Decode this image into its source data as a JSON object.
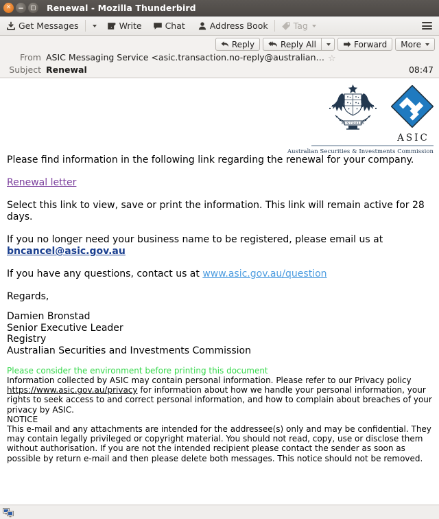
{
  "window": {
    "title": "Renewal - Mozilla Thunderbird",
    "controls": {
      "close": "close-button",
      "minimize": "minimize-button",
      "maximize": "maximize-button"
    }
  },
  "toolbar": {
    "get_messages": "Get Messages",
    "get_messages_icon": "download-inbox-icon",
    "get_messages_dropdown": "chevron-down-icon",
    "write": "Write",
    "write_icon": "compose-pencil-icon",
    "chat": "Chat",
    "chat_icon": "speech-bubble-icon",
    "address_book": "Address Book",
    "address_book_icon": "person-icon",
    "tag": "Tag",
    "tag_icon": "tag-icon",
    "app_menu_icon": "hamburger-menu-icon"
  },
  "message_actions": {
    "reply": "Reply",
    "reply_icon": "reply-arrow-icon",
    "reply_all": "Reply All",
    "reply_all_icon": "reply-all-arrow-icon",
    "reply_all_dropdown": "chevron-down-icon",
    "forward": "Forward",
    "forward_icon": "forward-arrow-icon",
    "more": "More",
    "more_dropdown": "chevron-down-icon"
  },
  "message_header": {
    "from_label": "From",
    "from_value": "ASIC Messaging Service <asic.transaction.no-reply@australian…",
    "star_icon": "star-outline-icon",
    "subject_label": "Subject",
    "subject_value": "Renewal",
    "time": "08:47"
  },
  "email": {
    "logo": {
      "coat_of_arms_icon": "australian-coat-of-arms-icon",
      "asic_diamond_icon": "asic-diamond-logo-icon",
      "wordmark": "ASIC",
      "tagline": "Australian Securities & Investments Commission"
    },
    "paragraphs": {
      "intro": "Please find information in the following link regarding the renewal for your company.",
      "link_label": "Renewal letter",
      "instructions": "Select this link to view, save or print the information. This link will remain active for 28 days.",
      "cancel_prefix": "If you no longer need your business name to be registered, please email us at",
      "cancel_email": "bncancel@asic.gov.au",
      "questions_prefix": "If you have any questions, contact us at",
      "questions_link": "www.asic.gov.au/question",
      "regards": "Regards,"
    },
    "signature": [
      "Damien Bronstad",
      "Senior Executive Leader",
      "Registry",
      "Australian Securities and Investments Commission"
    ],
    "green_note": "Please consider the environment before printing this document",
    "privacy": {
      "line1": "Information collected by ASIC may contain personal information. Please refer to our Privacy policy",
      "link": "https://www.asic.gov.au/privacy",
      "rest": " for information about how we handle your personal information, your rights to seek access to and correct personal information, and how to complain about breaches of your privacy by ASIC."
    },
    "notice": {
      "heading": "NOTICE",
      "body": "This e-mail and any attachments are intended for the addressee(s) only and may be confidential. They may contain legally privileged or copyright material. You should not read, copy, use or disclose them without authorisation. If you are not the intended recipient please contact the sender as soon as possible by return e-mail and then please delete both messages. This notice should not be removed."
    }
  },
  "statusbar": {
    "connection_icon": "network-computers-icon"
  },
  "colors": {
    "titlebar": "#4c4845",
    "toolbar": "#ece9e6",
    "header_pane": "#f3f1ef",
    "visited_link": "#7b3f9d",
    "blue_link": "#4e9de0",
    "strong_link": "#1a3f8f",
    "green_note": "#34d84a",
    "asic_blue": "#1f7ac0",
    "close_button": "#e9842f"
  }
}
